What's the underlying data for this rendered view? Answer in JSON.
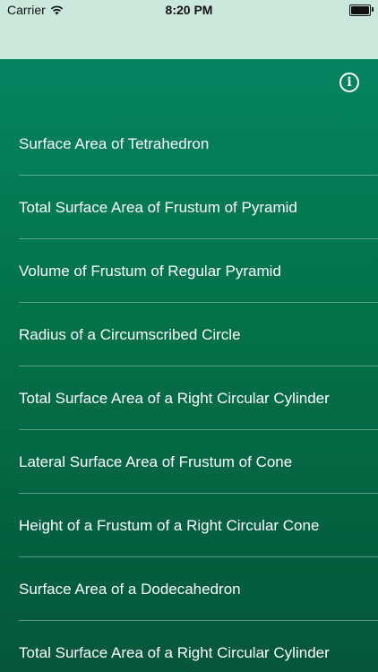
{
  "status_bar": {
    "carrier": "Carrier",
    "time": "8:20 PM",
    "wifi_icon": "wifi-icon",
    "battery_icon": "battery-icon",
    "background": "#cbe8dc"
  },
  "header": {
    "info_icon": "info-icon",
    "info_glyph": "i"
  },
  "theme": {
    "gradient_top": "#04845f",
    "gradient_bottom": "#05563a",
    "text_color": "#ffffff"
  },
  "list": {
    "items": [
      {
        "label": "Surface Area of Tetrahedron"
      },
      {
        "label": "Total Surface Area of Frustum of Pyramid"
      },
      {
        "label": "Volume of Frustum of Regular Pyramid"
      },
      {
        "label": "Radius of a Circumscribed Circle"
      },
      {
        "label": "Total Surface Area of a Right Circular Cylinder"
      },
      {
        "label": "Lateral Surface Area of Frustum of Cone"
      },
      {
        "label": "Height of a Frustum of a Right Circular Cone"
      },
      {
        "label": "Surface Area of a Dodecahedron"
      },
      {
        "label": "Total Surface Area of a Right Circular Cylinder"
      }
    ]
  }
}
